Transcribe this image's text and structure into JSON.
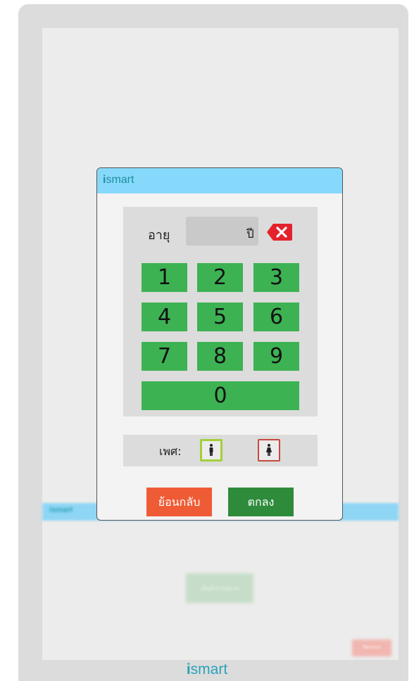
{
  "brand": {
    "logo_prefix": "i",
    "logo_suffix": "smart"
  },
  "background_app": {
    "header_logo": "ismart",
    "center_button_label": "เริ่มทำการตรวจ",
    "corner_button_label": "ปิดระบบ"
  },
  "dialog": {
    "age_label": "อายุ",
    "age_value": "",
    "age_unit": "ปี",
    "keypad": [
      "1",
      "2",
      "3",
      "4",
      "5",
      "6",
      "7",
      "8",
      "9",
      "0"
    ],
    "gender_label": "เพศ:",
    "back_label": "ย้อนกลับ",
    "ok_label": "ตกลง"
  },
  "colors": {
    "header": "#87d9fb",
    "key": "#3db253",
    "back_button": "#ef5b34",
    "ok_button": "#2e8b3b",
    "clear_button": "#e3222c"
  },
  "icons": {
    "clear": "backspace-icon",
    "male": "male-icon",
    "female": "female-icon"
  }
}
